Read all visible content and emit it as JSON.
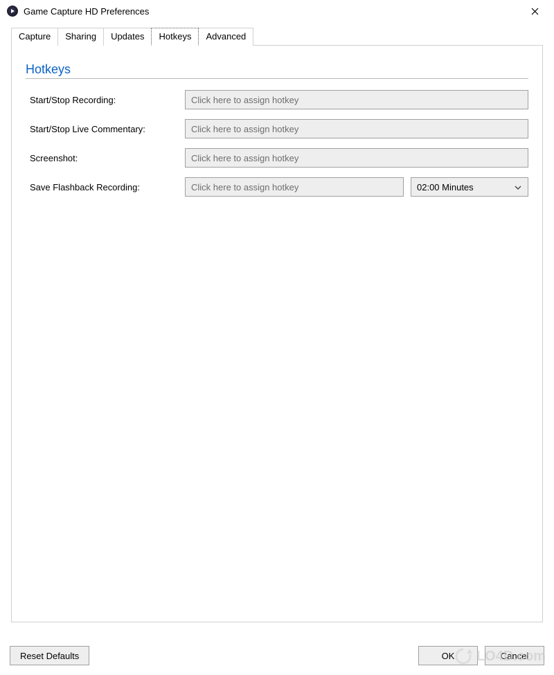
{
  "window": {
    "title": "Game Capture HD Preferences"
  },
  "tabs": {
    "items": [
      "Capture",
      "Sharing",
      "Updates",
      "Hotkeys",
      "Advanced"
    ],
    "active": "Hotkeys"
  },
  "section": {
    "title": "Hotkeys"
  },
  "rows": {
    "recording": {
      "label": "Start/Stop Recording:",
      "placeholder": "Click here to assign hotkey"
    },
    "commentary": {
      "label": "Start/Stop Live Commentary:",
      "placeholder": "Click here to assign hotkey"
    },
    "screenshot": {
      "label": "Screenshot:",
      "placeholder": "Click here to assign hotkey"
    },
    "flashback": {
      "label": "Save Flashback Recording:",
      "placeholder": "Click here to assign hotkey",
      "duration_selected": "02:00 Minutes"
    }
  },
  "footer": {
    "reset": "Reset Defaults",
    "ok": "OK",
    "cancel": "Cancel"
  },
  "watermark": "LO4D.com"
}
